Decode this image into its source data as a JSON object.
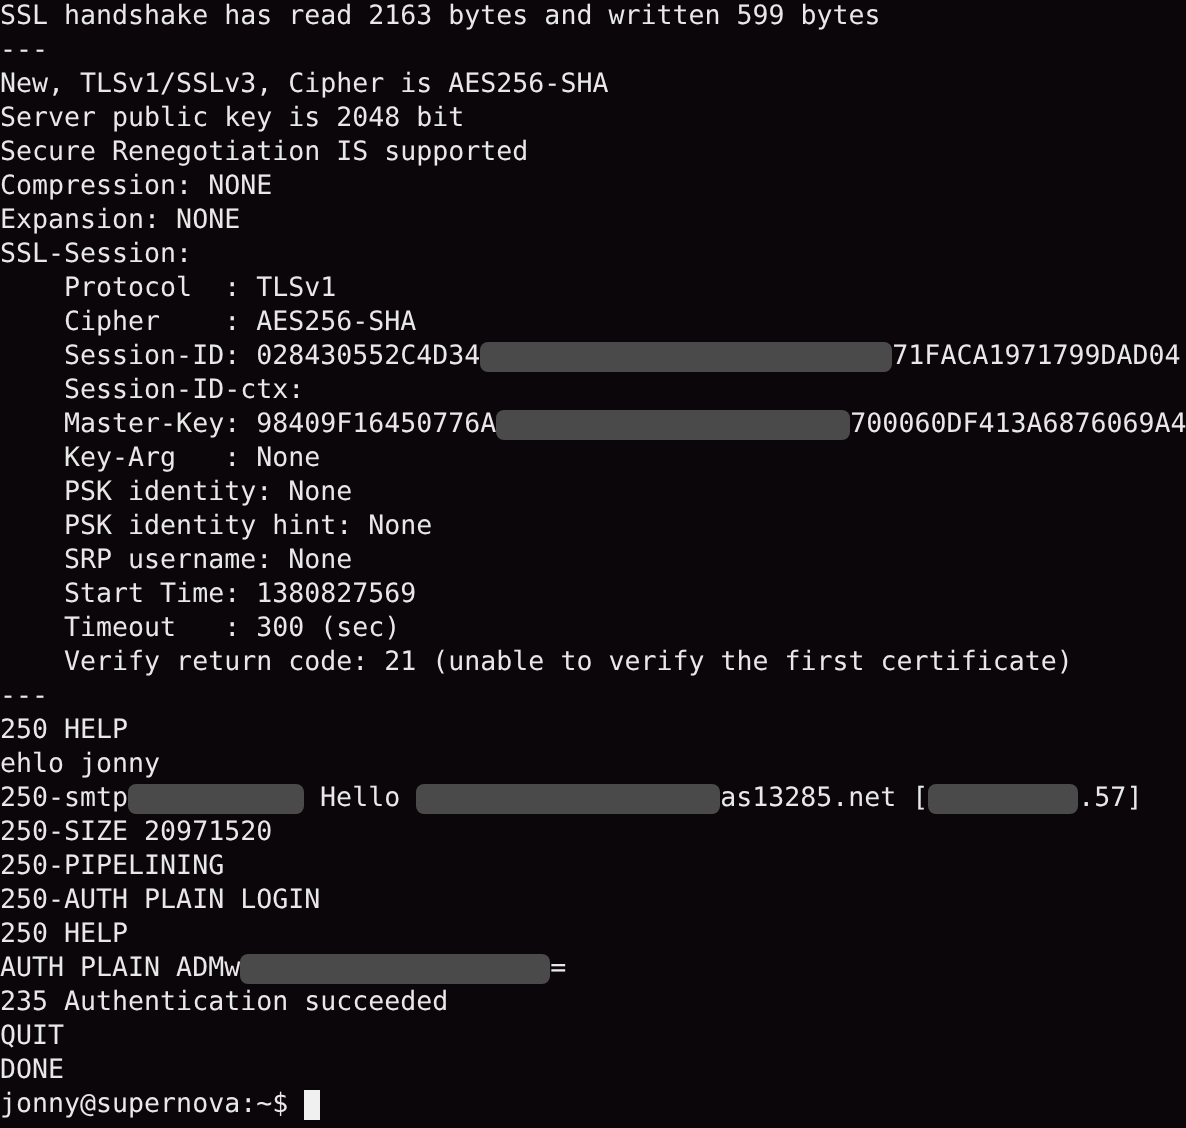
{
  "terminal": {
    "lines": [
      {
        "kind": "text",
        "text": "SSL handshake has read 2163 bytes and written 599 bytes"
      },
      {
        "kind": "text",
        "text": "---"
      },
      {
        "kind": "text",
        "text": "New, TLSv1/SSLv3, Cipher is AES256-SHA"
      },
      {
        "kind": "text",
        "text": "Server public key is 2048 bit"
      },
      {
        "kind": "text",
        "text": "Secure Renegotiation IS supported"
      },
      {
        "kind": "text",
        "text": "Compression: NONE"
      },
      {
        "kind": "text",
        "text": "Expansion: NONE"
      },
      {
        "kind": "text",
        "text": "SSL-Session:"
      },
      {
        "kind": "text",
        "text": "    Protocol  : TLSv1"
      },
      {
        "kind": "text",
        "text": "    Cipher    : AES256-SHA"
      },
      {
        "kind": "parts",
        "parts": [
          {
            "kind": "text",
            "text": "    Session-ID: 028430552C4D34"
          },
          {
            "kind": "redacted"
          },
          {
            "kind": "text",
            "text": "71FACA1971799DAD04"
          }
        ]
      },
      {
        "kind": "text",
        "text": "    Session-ID-ctx:"
      },
      {
        "kind": "parts",
        "parts": [
          {
            "kind": "text",
            "text": "    Master-Key: 98409F16450776A"
          },
          {
            "kind": "redacted"
          },
          {
            "kind": "text",
            "text": "700060DF413A6876069A4"
          }
        ]
      },
      {
        "kind": "text",
        "text": "    Key-Arg   : None"
      },
      {
        "kind": "text",
        "text": "    PSK identity: None"
      },
      {
        "kind": "text",
        "text": "    PSK identity hint: None"
      },
      {
        "kind": "text",
        "text": "    SRP username: None"
      },
      {
        "kind": "text",
        "text": "    Start Time: 1380827569"
      },
      {
        "kind": "text",
        "text": "    Timeout   : 300 (sec)"
      },
      {
        "kind": "text",
        "text": "    Verify return code: 21 (unable to verify the first certificate)"
      },
      {
        "kind": "text",
        "text": "---"
      },
      {
        "kind": "text",
        "text": "250 HELP"
      },
      {
        "kind": "text",
        "text": "ehlo jonny"
      },
      {
        "kind": "parts",
        "parts": [
          {
            "kind": "text",
            "text": "250-smtp"
          },
          {
            "kind": "redacted"
          },
          {
            "kind": "text",
            "text": " Hello "
          },
          {
            "kind": "redacted"
          },
          {
            "kind": "text",
            "text": "as13285.net ["
          },
          {
            "kind": "redacted"
          },
          {
            "kind": "text",
            "text": ".57]"
          }
        ]
      },
      {
        "kind": "text",
        "text": "250-SIZE 20971520"
      },
      {
        "kind": "text",
        "text": "250-PIPELINING"
      },
      {
        "kind": "text",
        "text": "250-AUTH PLAIN LOGIN"
      },
      {
        "kind": "text",
        "text": "250 HELP"
      },
      {
        "kind": "parts",
        "parts": [
          {
            "kind": "text",
            "text": "AUTH PLAIN ADMw"
          },
          {
            "kind": "redacted"
          },
          {
            "kind": "text",
            "text": "="
          }
        ]
      },
      {
        "kind": "text",
        "text": "235 Authentication succeeded"
      },
      {
        "kind": "text",
        "text": "QUIT"
      },
      {
        "kind": "text",
        "text": "DONE"
      },
      {
        "kind": "prompt",
        "text": "jonny@supernova:~$",
        "cursor": true
      }
    ]
  }
}
